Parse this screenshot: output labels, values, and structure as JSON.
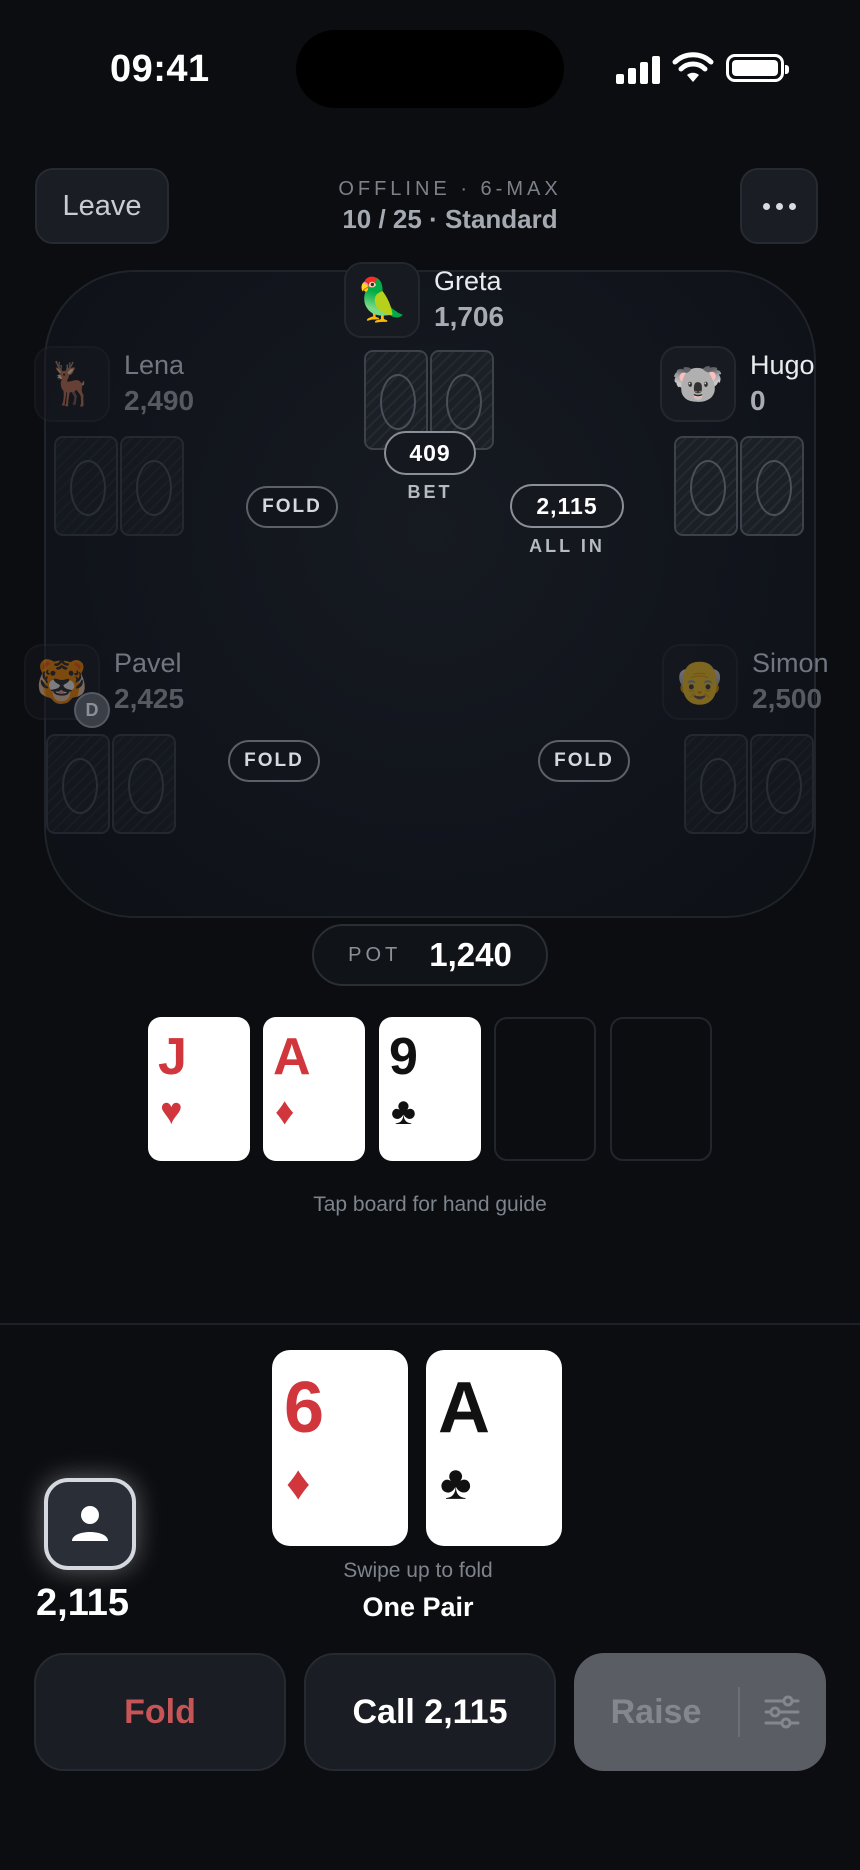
{
  "status_bar": {
    "time": "09:41"
  },
  "header": {
    "leave_label": "Leave",
    "subtitle": "OFFLINE · 6-MAX",
    "title": "10 / 25 · Standard",
    "more_icon": "ellipsis-icon"
  },
  "players": {
    "greta": {
      "name": "Greta",
      "chips": "1,706",
      "avatar": "🦜",
      "bet": "409",
      "bet_label": "BET"
    },
    "lena": {
      "name": "Lena",
      "chips": "2,490",
      "avatar": "🦌",
      "action": "FOLD"
    },
    "hugo": {
      "name": "Hugo",
      "chips": "0",
      "avatar": "🐨",
      "bet": "2,115",
      "bet_label": "ALL IN"
    },
    "pavel": {
      "name": "Pavel",
      "chips": "2,425",
      "avatar": "🐯",
      "action": "FOLD",
      "dealer": "D"
    },
    "simon": {
      "name": "Simon",
      "chips": "2,500",
      "avatar": "👴",
      "action": "FOLD"
    }
  },
  "pot": {
    "label": "POT",
    "value": "1,240"
  },
  "board": {
    "cards": [
      {
        "rank": "J",
        "suit": "♥",
        "color": "#d0363b"
      },
      {
        "rank": "A",
        "suit": "♦",
        "color": "#d0363b"
      },
      {
        "rank": "9",
        "suit": "♣",
        "color": "#111111"
      }
    ],
    "hint": "Tap board for hand guide"
  },
  "hero": {
    "chips": "2,115",
    "cards": [
      {
        "rank": "6",
        "suit": "♦",
        "color": "#d0363b"
      },
      {
        "rank": "A",
        "suit": "♣",
        "color": "#111111"
      }
    ],
    "swipe_hint": "Swipe up to fold",
    "hand_name": "One Pair"
  },
  "actions": {
    "fold": "Fold",
    "call": "Call 2,115",
    "raise": "Raise"
  }
}
